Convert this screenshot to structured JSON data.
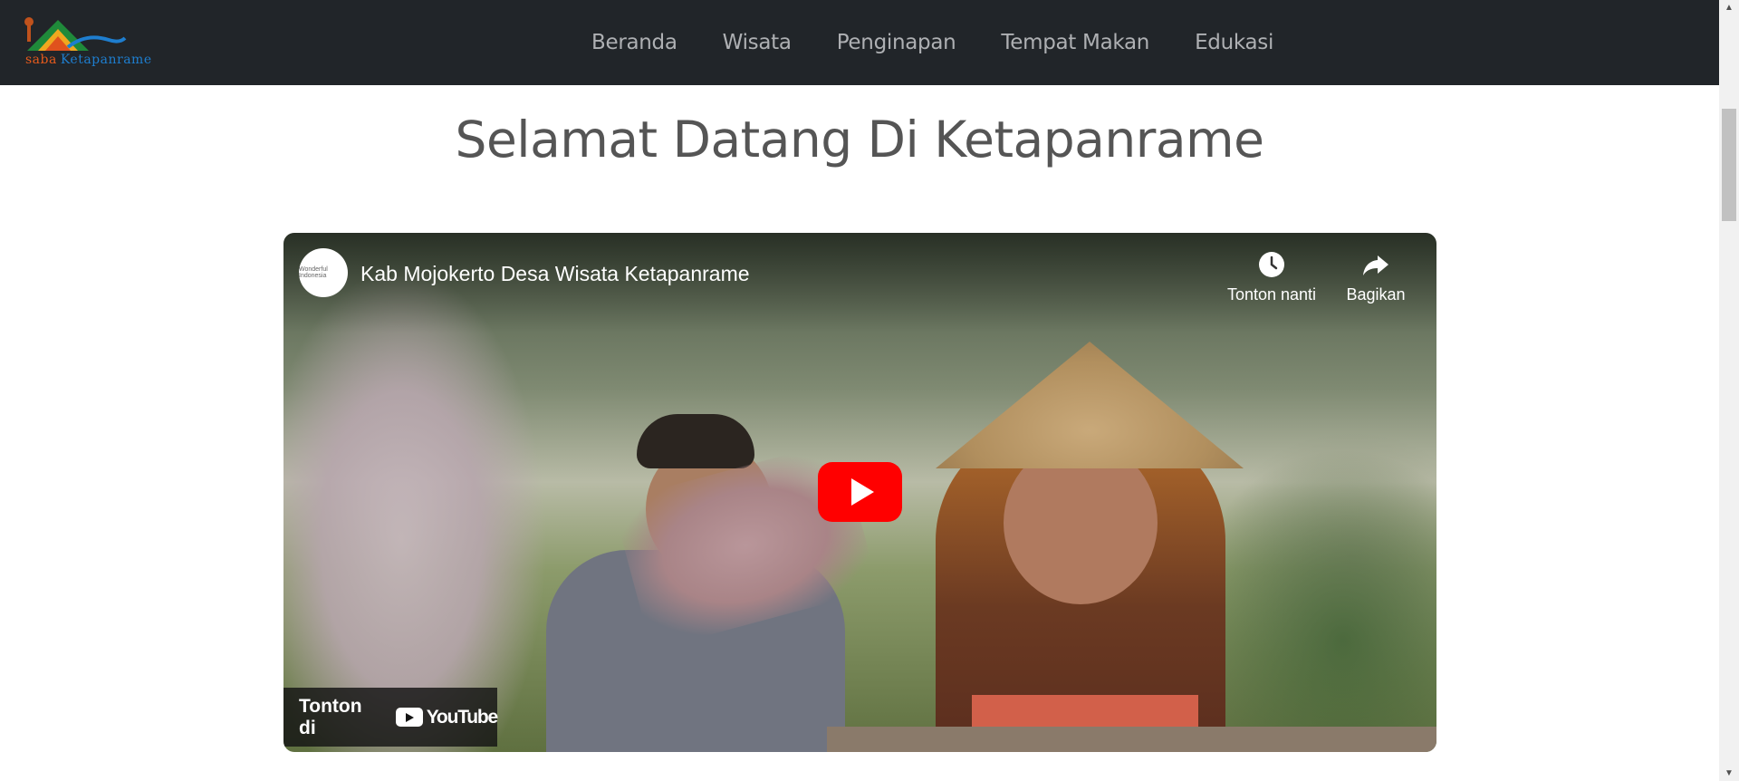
{
  "nav": {
    "logo": {
      "text_a": "saba",
      "text_b": "Ketapanrame"
    },
    "items": [
      {
        "label": "Beranda"
      },
      {
        "label": "Wisata"
      },
      {
        "label": "Penginapan"
      },
      {
        "label": "Tempat Makan"
      },
      {
        "label": "Edukasi"
      }
    ]
  },
  "main": {
    "title": "Selamat Datang Di Ketapanrame"
  },
  "video": {
    "title": "Kab Mojokerto Desa Wisata Ketapanrame",
    "watch_later": "Tonton nanti",
    "share": "Bagikan",
    "watch_on": "Tonton di",
    "youtube_word": "YouTube",
    "channel_avatar_text": "Wonderful Indonesia"
  },
  "colors": {
    "navbar_bg": "#212529",
    "nav_link": "#aeb0b3",
    "title": "#555555",
    "youtube_red": "#ff0000"
  },
  "icons": {
    "logo": "saba-ketapanrame-logo",
    "watch_later": "clock-icon",
    "share": "share-arrow-icon",
    "play": "play-icon"
  }
}
